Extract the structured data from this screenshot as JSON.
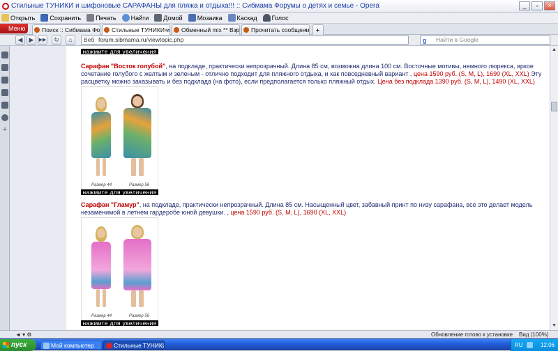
{
  "window": {
    "title": "Стильные ТУНИКИ и шифоновые САРАФАНЫ для пляжа и отдыха!!! :: Сибмама Форумы о детях и семье - Opera",
    "minimize": "_",
    "restore": "▫",
    "close": "×"
  },
  "toolbar": {
    "items": [
      {
        "label": "Открыть",
        "icon": "open-folder-icon"
      },
      {
        "label": "Сохранить",
        "icon": "save-icon"
      },
      {
        "label": "Печать",
        "icon": "print-icon"
      },
      {
        "label": "Найти",
        "icon": "find-icon"
      },
      {
        "label": "Домой",
        "icon": "home-icon"
      },
      {
        "label": "Мозаика",
        "icon": "tile-icon"
      },
      {
        "label": "Каскад",
        "icon": "cascade-icon"
      },
      {
        "label": "Голос",
        "icon": "voice-icon"
      }
    ]
  },
  "menu_button": "Меню",
  "tabs": [
    {
      "label": "Поиск :: Сибмама Форум..."
    },
    {
      "label": "Стильные ТУНИКИ и ш..."
    },
    {
      "label": "Обменный mix ** Взрос..."
    },
    {
      "label": "Прочитать сообщение ..."
    }
  ],
  "new_tab": "+",
  "nav": {
    "back": "◀",
    "forward": "▶",
    "fast_forward": "▶▶",
    "reload": "↻",
    "home": "⌂",
    "address_label": "Веб",
    "url": "forum.sibmama.ru/viewtopic.php",
    "search_engine": "g",
    "search_placeholder": "Найти в Google"
  },
  "posts": {
    "top_caption": "нажмите для увеличения",
    "item1": {
      "name": "Сарафан \"Восток голубой\"",
      "text_part1": ", на подкладе, практически непрозрачный. Длина 85 см, возможна длина 100 см. Восточные мотивы, немного люрекса, яркое сочетание голубого с желтым и зеленым - отлично подходит для пляжного отдыха, и как повседневный вариант ,",
      "price1": " цена 1590 руб. (S, M, L), 1690 (XL, XXL)",
      "text_part2": " Эту расцветку можно заказывать и без подклада (на фото), если предполагается только пляжный отдых.",
      "price2": " Цена без подклада 1390 руб. (S, M, L), 1490 (XL, XXL)",
      "size_left": "Размер 44",
      "size_right": "Размер 56",
      "caption": "нажмите для увеличения",
      "dress_colors": [
        "#3a8fa8",
        "#e6a23a",
        "#6db06a"
      ]
    },
    "item2": {
      "name": "Сарафан \"Гламур\"",
      "text_part1": ", на подкладе, практически непрозрачный. Длина 85 см. Насыщенный цвет, забавный принт по низу сарафана, все это делает модель незаменимой в летнем гардеробе юной девушки. ,",
      "price1": " цена 1590 руб. (S, M, L), 1690 (XL, XXL)",
      "size_left": "Размер 44",
      "size_right": "Размер 56",
      "caption": "нажмите для увеличения",
      "dress_colors": [
        "#e46fc6",
        "#f2a6dc",
        "#5a9fd0"
      ]
    }
  },
  "status": {
    "left_icons": "◄ ▾ ⚙",
    "message": "Обновление готово к установке",
    "zoom": "Вид (100%)"
  },
  "taskbar": {
    "start": "пуск",
    "tasks": [
      {
        "label": "Мой компьютер"
      },
      {
        "label": "Стильные ТУНИКИ и..."
      }
    ],
    "lang": "RU",
    "time": "12:06"
  }
}
